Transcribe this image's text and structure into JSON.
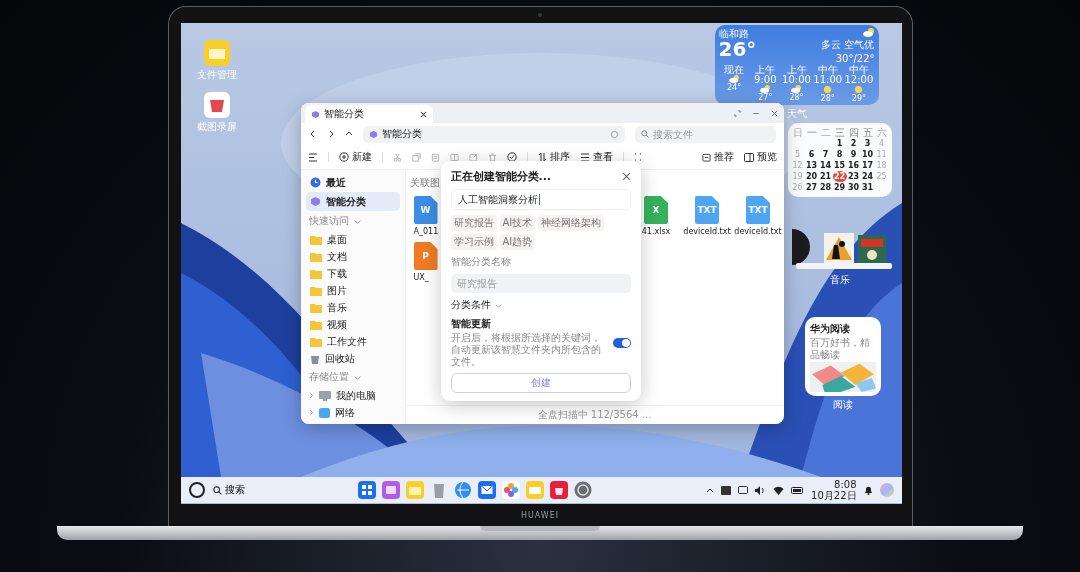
{
  "laptop": {
    "brand": "HUAWEI"
  },
  "desktop_icons": [
    {
      "label": "文件管理",
      "kind": "folder"
    },
    {
      "label": "截图录屏",
      "kind": "cup"
    }
  ],
  "weather": {
    "location": "临和路",
    "temperature": "26°",
    "condition": "多云 空气优",
    "range": "30°/22°",
    "caption": "天气",
    "hours": [
      {
        "time": "现在",
        "kind": "cloudy",
        "temp": "24°"
      },
      {
        "time": "上午9:00",
        "kind": "cloudy",
        "temp": "27°"
      },
      {
        "time": "上午10:00",
        "kind": "cloudy",
        "temp": "28°"
      },
      {
        "time": "中午11:00",
        "kind": "sunny",
        "temp": "28°"
      },
      {
        "time": "中午12:00",
        "kind": "sunny",
        "temp": "29°"
      }
    ]
  },
  "calendar": {
    "weekdays": [
      "日",
      "一",
      "二",
      "三",
      "四",
      "五",
      "六"
    ],
    "weeks": [
      [
        {
          "d": "1",
          "selected": false
        },
        {
          "d": "2",
          "selected": false
        },
        {
          "d": "3",
          "selected": false
        },
        {
          "d": "4",
          "selected": false
        }
      ],
      [
        {
          "d": "5",
          "selected": false
        },
        {
          "d": "6",
          "selected": false
        },
        {
          "d": "7",
          "selected": false
        },
        {
          "d": "8",
          "selected": false
        },
        {
          "d": "9",
          "selected": false
        },
        {
          "d": "10",
          "selected": false
        },
        {
          "d": "11",
          "selected": false
        }
      ],
      [
        {
          "d": "12",
          "selected": false
        },
        {
          "d": "13",
          "selected": false
        },
        {
          "d": "14",
          "selected": false
        },
        {
          "d": "15",
          "selected": false
        },
        {
          "d": "16",
          "selected": false
        },
        {
          "d": "17",
          "selected": false
        },
        {
          "d": "18",
          "selected": false
        }
      ],
      [
        {
          "d": "19",
          "selected": false
        },
        {
          "d": "20",
          "selected": false
        },
        {
          "d": "21",
          "selected": false
        },
        {
          "d": "22",
          "selected": true
        },
        {
          "d": "23",
          "selected": false
        },
        {
          "d": "24",
          "selected": false
        },
        {
          "d": "25",
          "selected": false
        }
      ],
      [
        {
          "d": "26",
          "selected": false
        },
        {
          "d": "27",
          "selected": false
        },
        {
          "d": "28",
          "selected": false
        },
        {
          "d": "29",
          "selected": false
        },
        {
          "d": "30",
          "selected": false
        },
        {
          "d": "31",
          "selected": false
        }
      ]
    ]
  },
  "music": {
    "caption": "音乐"
  },
  "reading": {
    "title": "华为阅读",
    "subtitle": "百万好书，精品畅读",
    "caption": "阅读"
  },
  "file_manager": {
    "tab": "智能分类",
    "path": "智能分类",
    "search": {
      "placeholder": "搜索文件"
    },
    "toolbar": {
      "new": "新建",
      "sort": "排序",
      "view": "查看",
      "recommend": "推荐",
      "preview": "预览"
    },
    "sidebar": {
      "items": [
        {
          "label": "最近",
          "kind": "recent",
          "selected": false
        },
        {
          "label": "智能分类",
          "kind": "smart",
          "selected": true
        }
      ],
      "sections": [
        {
          "title": "快速访问",
          "expanded": true,
          "items": [
            {
              "label": "桌面",
              "kind": "folder",
              "selected": false
            },
            {
              "label": "文档",
              "kind": "folder",
              "selected": false
            },
            {
              "label": "下载",
              "kind": "folder",
              "selected": false
            },
            {
              "label": "图片",
              "kind": "folder",
              "selected": false
            },
            {
              "label": "音乐",
              "kind": "folder",
              "selected": false
            },
            {
              "label": "视频",
              "kind": "folder",
              "selected": false
            },
            {
              "label": "工作文件",
              "kind": "folder",
              "selected": false
            },
            {
              "label": "回收站",
              "kind": "trash",
              "selected": false
            }
          ]
        },
        {
          "title": "存储位置",
          "expanded": true,
          "items": [
            {
              "label": "我的电脑",
              "kind": "computer",
              "selected": false,
              "expanded": false
            },
            {
              "label": "网络",
              "kind": "network",
              "selected": false,
              "expanded": false
            }
          ]
        }
      ]
    },
    "content": {
      "heading": "关联图",
      "rows": [
        [
          {
            "name": "A_011",
            "kind": "word",
            "badge": "W"
          },
          {
            "name": "41.xlsx",
            "kind": "excel",
            "badge": "X"
          },
          {
            "name": "deviceId.txt",
            "kind": "txt",
            "badge": "TXT"
          },
          {
            "name": "deviceId.txt",
            "kind": "txt",
            "badge": "TXT"
          }
        ],
        [
          {
            "name": "UX_",
            "kind": "ppt",
            "badge": "P"
          }
        ]
      ]
    },
    "status": "全盘扫描中 112/3564 ..."
  },
  "dialog": {
    "title": "正在创建智能分类...",
    "query": "人工智能洞察分析",
    "keywords": [
      "研究报告",
      "AI技术",
      "神经网络架构",
      "学习示例",
      "AI趋势"
    ],
    "name_field": {
      "label": "智能分类名称",
      "placeholder": "研究报告"
    },
    "conditions": {
      "label": "分类条件",
      "expanded": false
    },
    "smart_update": {
      "title": "智能更新",
      "description": "开启后，将根据所选择的关键词，自动更新该智慧文件夹内所包含的文件。",
      "on": true
    },
    "button": "创建"
  },
  "taskbar": {
    "search": "搜索",
    "time": "8:08",
    "date": "10月22日"
  }
}
